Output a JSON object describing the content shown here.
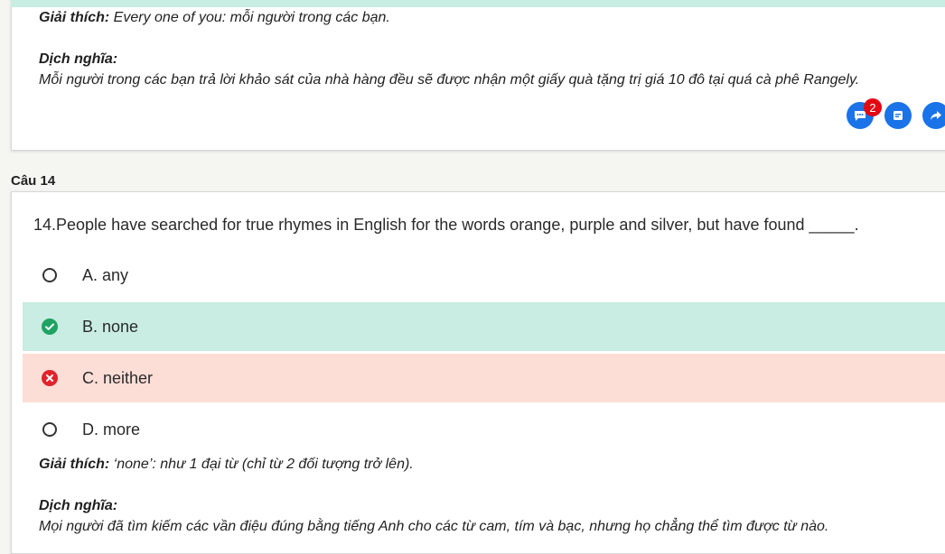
{
  "prev": {
    "explanation_label": "Giải thích:",
    "explanation_text": " Every one of you: mỗi người trong các bạn.",
    "translation_label": "Dịch nghĩa:",
    "translation_text": "Mỗi người trong các bạn trả lời khảo sát của nhà hàng đều sẽ được nhận một giấy quà tặng trị giá 10 đô tại quá cà phê Rangely.",
    "comment_badge": "2"
  },
  "question": {
    "label": "Câu 14",
    "text": "14.People have searched for true rhymes in English for the words orange, purple and silver, but have found _____.",
    "options": [
      {
        "text": "A. any",
        "state": "unselected"
      },
      {
        "text": "B. none",
        "state": "correct"
      },
      {
        "text": "C. neither",
        "state": "wrong"
      },
      {
        "text": "D. more",
        "state": "unselected"
      }
    ],
    "explanation_label": "Giải thích:",
    "explanation_text": " ‘none’: như 1 đại từ (chỉ từ 2 đối tượng trở lên).",
    "translation_label": "Dịch nghĩa:",
    "translation_text": "Mọi người đã tìm kiếm các vần điệu đúng bằng tiếng Anh cho các từ cam, tím và bạc, nhưng họ chẳng thể tìm được từ nào."
  },
  "colors": {
    "correct_bg": "#c9ede2",
    "wrong_bg": "#fdded7",
    "correct_icon": "#1ea362",
    "wrong_icon": "#e0242b",
    "action_blue": "#1a73e8"
  }
}
